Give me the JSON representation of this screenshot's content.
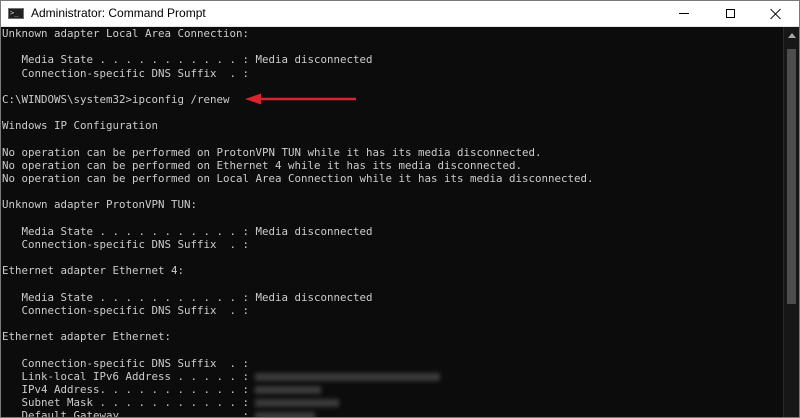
{
  "window": {
    "title": "Administrator: Command Prompt",
    "icon": "cmd-icon",
    "icon_text": ">_",
    "controls": [
      "minimize",
      "maximize",
      "close"
    ]
  },
  "console": {
    "lines": [
      {
        "text": "Unknown adapter Local Area Connection:"
      },
      {
        "text": ""
      },
      {
        "text": "   Media State . . . . . . . . . . . : Media disconnected"
      },
      {
        "text": "   Connection-specific DNS Suffix  . :"
      },
      {
        "text": ""
      },
      {
        "text": "C:\\WINDOWS\\system32>ipconfig /renew"
      },
      {
        "text": ""
      },
      {
        "text": "Windows IP Configuration"
      },
      {
        "text": ""
      },
      {
        "text": "No operation can be performed on ProtonVPN TUN while it has its media disconnected."
      },
      {
        "text": "No operation can be performed on Ethernet 4 while it has its media disconnected."
      },
      {
        "text": "No operation can be performed on Local Area Connection while it has its media disconnected."
      },
      {
        "text": ""
      },
      {
        "text": "Unknown adapter ProtonVPN TUN:"
      },
      {
        "text": ""
      },
      {
        "text": "   Media State . . . . . . . . . . . : Media disconnected"
      },
      {
        "text": "   Connection-specific DNS Suffix  . :"
      },
      {
        "text": ""
      },
      {
        "text": "Ethernet adapter Ethernet 4:"
      },
      {
        "text": ""
      },
      {
        "text": "   Media State . . . . . . . . . . . : Media disconnected"
      },
      {
        "text": "   Connection-specific DNS Suffix  . :"
      },
      {
        "text": ""
      },
      {
        "text": "Ethernet adapter Ethernet:"
      },
      {
        "text": ""
      },
      {
        "text": "   Connection-specific DNS Suffix  . :"
      },
      {
        "text": "   Link-local IPv6 Address . . . . . :",
        "redacted": true
      },
      {
        "text": "   IPv4 Address. . . . . . . . . . . :",
        "redacted": true
      },
      {
        "text": "   Subnet Mask . . . . . . . . . . . :",
        "redacted": true
      },
      {
        "text": "   Default Gateway . . . . . . . . . :",
        "redacted": true
      }
    ]
  },
  "annotation": {
    "type": "arrow",
    "color": "#d9232d",
    "points_to": "ipconfig /renew"
  },
  "colors": {
    "console_background": "#0c0c0c",
    "console_text": "#cccccc",
    "titlebar_background": "#ffffff"
  }
}
